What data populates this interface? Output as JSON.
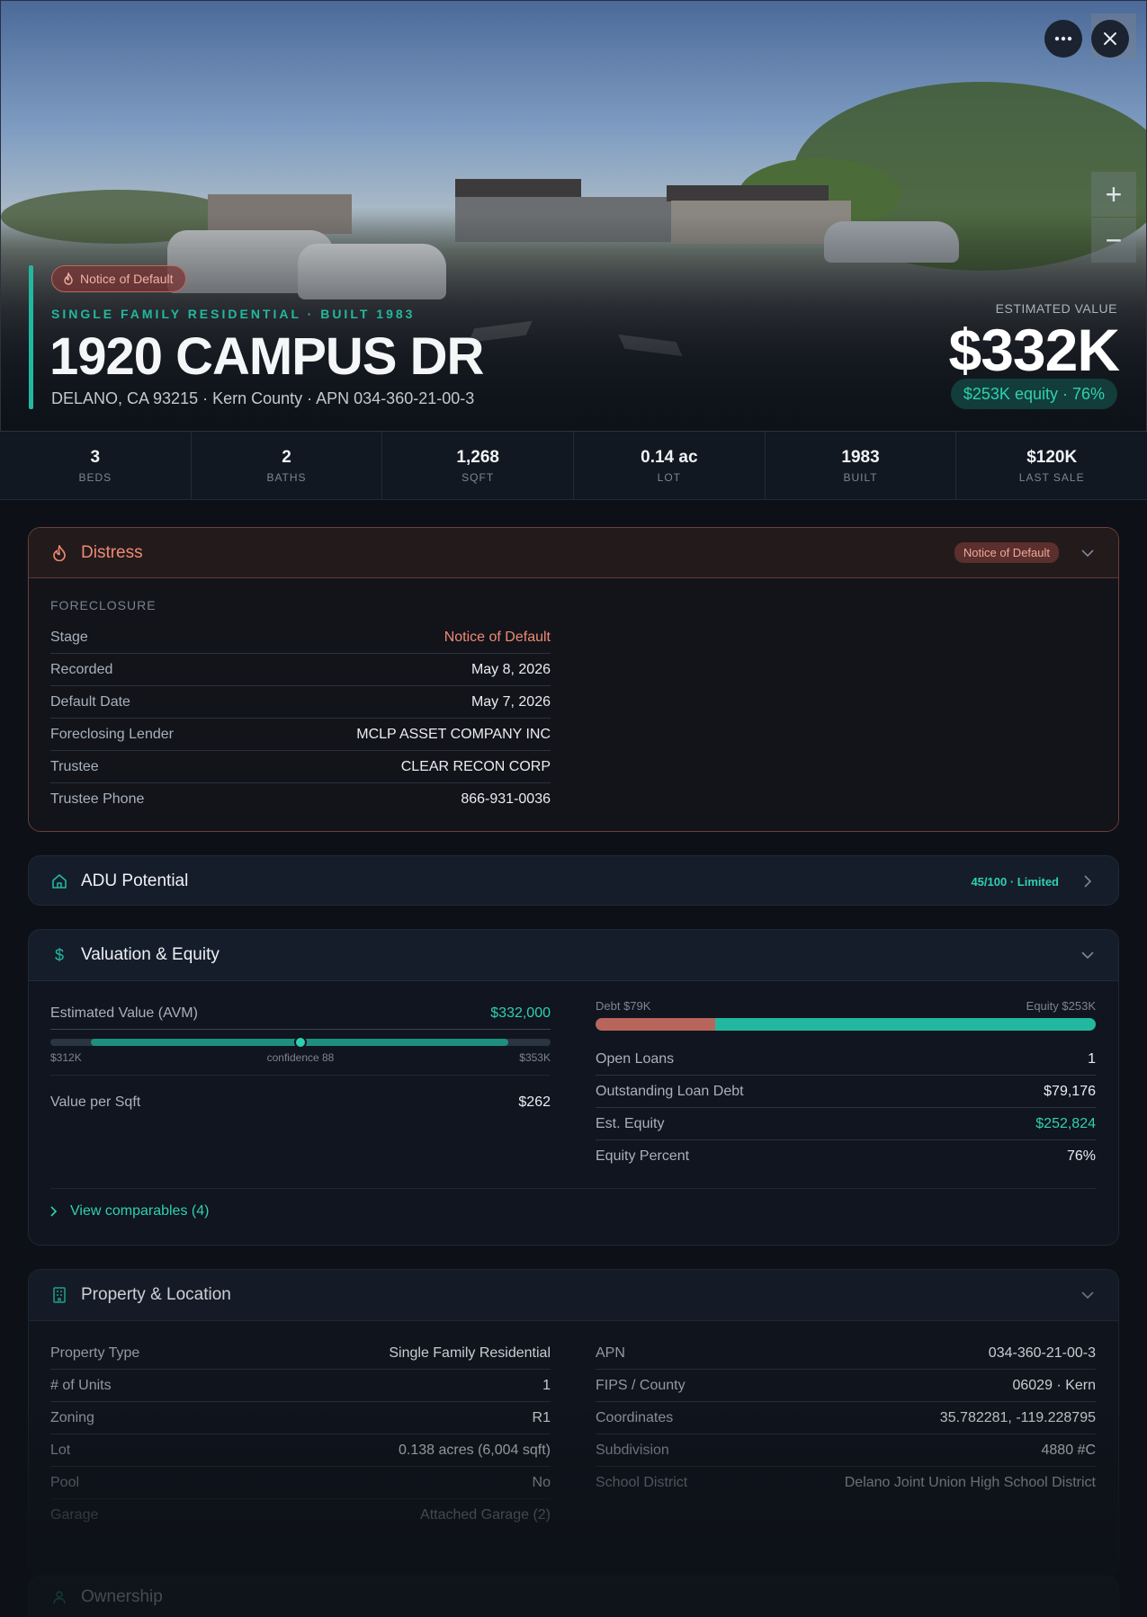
{
  "hero": {
    "badge": "Notice of Default",
    "type_line": "SINGLE FAMILY RESIDENTIAL · BUILT 1983",
    "address": "1920 CAMPUS DR",
    "subaddress": "DELANO, CA 93215 · Kern County · APN 034-360-21-00-3",
    "est_label": "ESTIMATED VALUE",
    "est_value": "$332K",
    "equity_pill": "$253K equity · 76%",
    "more_icon": "ellipsis-icon",
    "close_icon": "close-icon",
    "zoom_in": "+",
    "zoom_out": "−"
  },
  "stats": [
    {
      "value": "3",
      "label": "BEDS"
    },
    {
      "value": "2",
      "label": "BATHS"
    },
    {
      "value": "1,268",
      "label": "SQFT"
    },
    {
      "value": "0.14 ac",
      "label": "LOT"
    },
    {
      "value": "1983",
      "label": "BUILT"
    },
    {
      "value": "$120K",
      "label": "LAST SALE"
    }
  ],
  "distress": {
    "title": "Distress",
    "pill": "Notice of Default",
    "section": "FORECLOSURE",
    "rows": [
      {
        "k": "Stage",
        "v": "Notice of Default"
      },
      {
        "k": "Recorded",
        "v": "May 8, 2026"
      },
      {
        "k": "Default Date",
        "v": "May 7, 2026"
      },
      {
        "k": "Foreclosing Lender",
        "v": "MCLP ASSET COMPANY INC"
      },
      {
        "k": "Trustee",
        "v": "CLEAR RECON CORP"
      },
      {
        "k": "Trustee Phone",
        "v": "866-931-0036"
      }
    ]
  },
  "adu": {
    "title": "ADU Potential",
    "score": "45/100 · Limited"
  },
  "valuation": {
    "title": "Valuation & Equity",
    "avm_label": "Estimated Value (AVM)",
    "avm_value": "$332,000",
    "range_low": "$312K",
    "range_conf": "confidence 88",
    "range_high": "$353K",
    "range_position": 0.5,
    "vps_label": "Value per Sqft",
    "vps_value": "$262",
    "debt_label": "Debt $79K",
    "equity_label": "Equity $253K",
    "debt_fraction": 0.24,
    "rows": [
      {
        "k": "Open Loans",
        "v": "1"
      },
      {
        "k": "Outstanding Loan Debt",
        "v": "$79,176"
      },
      {
        "k": "Est. Equity",
        "v": "$252,824"
      },
      {
        "k": "Equity Percent",
        "v": "76%"
      }
    ],
    "comps_link": "View comparables (4)"
  },
  "property": {
    "title": "Property & Location",
    "left": [
      {
        "k": "Property Type",
        "v": "Single Family Residential"
      },
      {
        "k": "# of Units",
        "v": "1"
      },
      {
        "k": "Zoning",
        "v": "R1"
      },
      {
        "k": "Lot",
        "v": "0.138 acres (6,004 sqft)"
      },
      {
        "k": "Pool",
        "v": "No"
      },
      {
        "k": "Garage",
        "v": "Attached Garage (2)"
      }
    ],
    "right": [
      {
        "k": "APN",
        "v": "034-360-21-00-3"
      },
      {
        "k": "FIPS / County",
        "v": "06029 · Kern"
      },
      {
        "k": "Coordinates",
        "v": "35.782281, -119.228795"
      },
      {
        "k": "Subdivision",
        "v": "4880 #C"
      },
      {
        "k": "School District",
        "v": "Delano Joint Union High School District"
      }
    ]
  },
  "ownership": {
    "title": "Ownership"
  },
  "colors": {
    "accent": "#22b8a0",
    "distress": "#f08a72",
    "debt": "#b8655c",
    "equity": "#22b8a0"
  }
}
